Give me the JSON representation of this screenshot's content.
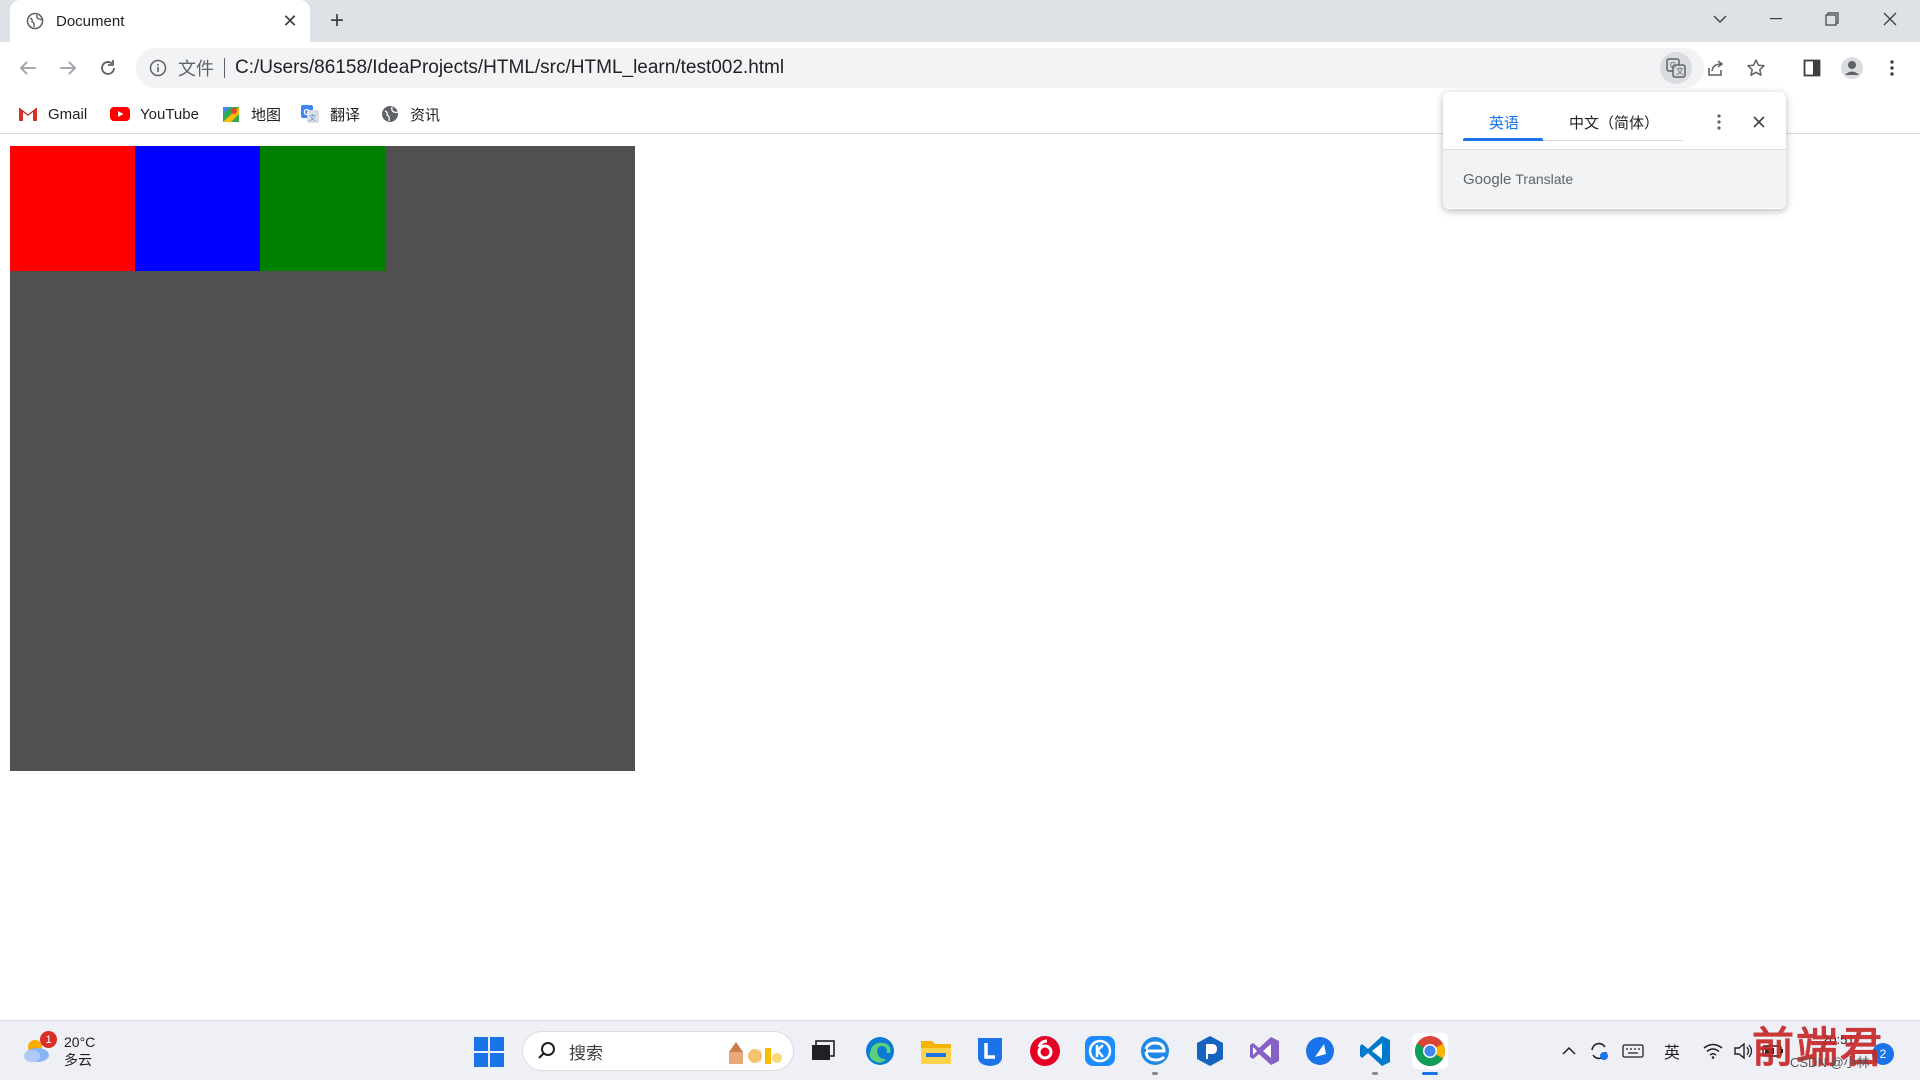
{
  "browser": {
    "tab": {
      "title": "Document",
      "close": "✕"
    },
    "new_tab": "+",
    "address": {
      "scheme_label": "文件",
      "url": "C:/Users/86158/IdeaProjects/HTML/src/HTML_learn/test002.html"
    },
    "bookmarks": [
      {
        "label": "Gmail",
        "icon": "gmail-icon"
      },
      {
        "label": "YouTube",
        "icon": "youtube-icon"
      },
      {
        "label": "地图",
        "icon": "maps-icon"
      },
      {
        "label": "翻译",
        "icon": "translate-icon"
      },
      {
        "label": "资讯",
        "icon": "globe-icon"
      }
    ]
  },
  "page": {
    "outer_box_color": "#505050",
    "boxes": [
      {
        "color": "#ff0000"
      },
      {
        "color": "#0000ff"
      },
      {
        "color": "#008000"
      }
    ]
  },
  "translate_popup": {
    "tab_source": "英语",
    "tab_target": "中文（简体）",
    "brand_google": "Google",
    "brand_translate": "Translate",
    "close": "✕"
  },
  "taskbar": {
    "weather": {
      "temp": "20°C",
      "condition": "多云",
      "badge": "1"
    },
    "search_label": "搜索",
    "input_indicator": "英",
    "clock_time": "20:51",
    "notifications": "2",
    "apps": [
      "task-view",
      "edge",
      "file-explorer",
      "app-l",
      "netease-music",
      "kugou",
      "ie-edge",
      "app-p",
      "visual-studio",
      "app-arrow",
      "vscode",
      "chrome"
    ]
  },
  "watermark": {
    "text": "前端君",
    "sub": "CSDN @小林"
  }
}
